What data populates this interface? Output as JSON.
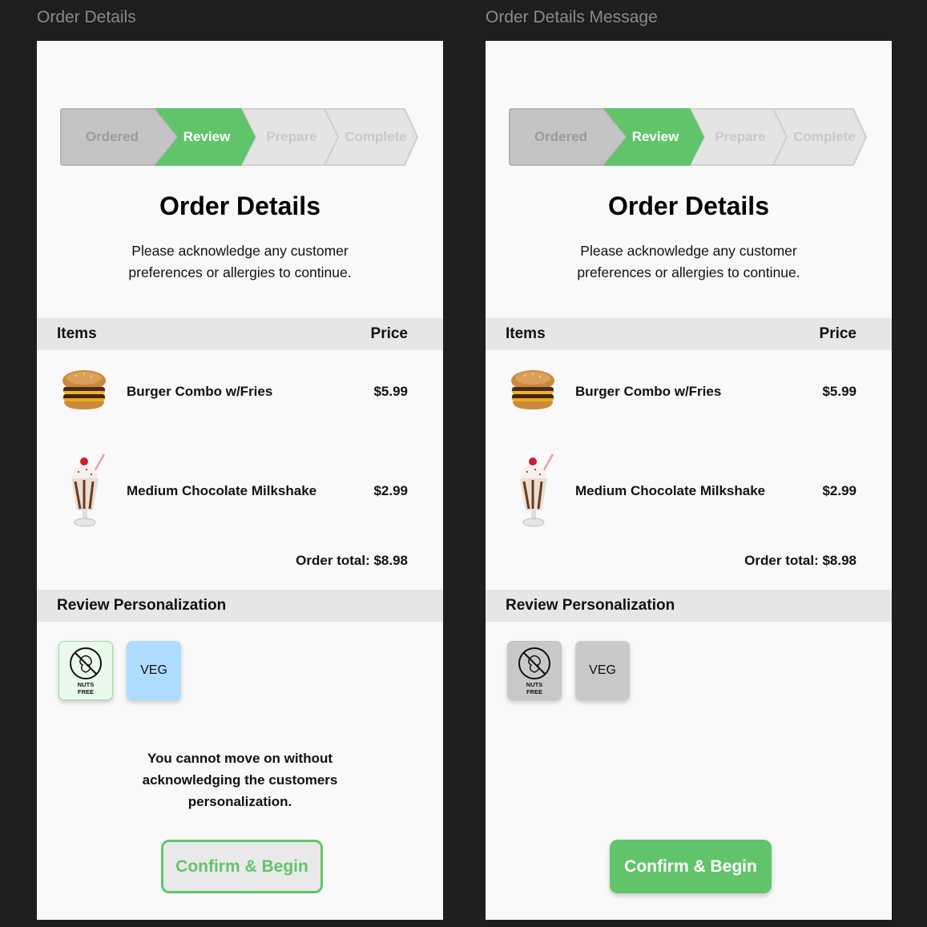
{
  "frames": [
    {
      "label": "Order Details",
      "steps": [
        "Ordered",
        "Review",
        "Prepare",
        "Complete"
      ],
      "title": "Order Details",
      "subtitle": "Please acknowledge  any customer\npreferences or allergies to continue.",
      "items_header": {
        "items": "Items",
        "price": "Price"
      },
      "items": [
        {
          "name": "Burger Combo w/Fries",
          "price": "$5.99",
          "icon": "burger-icon"
        },
        {
          "name": "Medium Chocolate Milkshake",
          "price": "$2.99",
          "icon": "milkshake-icon"
        }
      ],
      "order_total": "Order total: $8.98",
      "personalization_header": "Review Personalization",
      "badges": {
        "nuts": "NUTS\nFREE",
        "veg": "VEG"
      },
      "warning": "You cannot move on without\nacknowledging the customers\npersonalization.",
      "confirm_label": "Confirm & Begin"
    },
    {
      "label": "Order Details Message",
      "steps": [
        "Ordered",
        "Review",
        "Prepare",
        "Complete"
      ],
      "title": "Order Details",
      "subtitle": "Please acknowledge  any customer\npreferences or allergies to continue.",
      "items_header": {
        "items": "Items",
        "price": "Price"
      },
      "items": [
        {
          "name": "Burger Combo w/Fries",
          "price": "$5.99",
          "icon": "burger-icon"
        },
        {
          "name": "Medium Chocolate Milkshake",
          "price": "$2.99",
          "icon": "milkshake-icon"
        }
      ],
      "order_total": "Order total: $8.98",
      "personalization_header": "Review Personalization",
      "badges": {
        "nuts": "NUTS\nFREE",
        "veg": "VEG"
      },
      "confirm_label": "Confirm & Begin"
    }
  ],
  "colors": {
    "accent_green": "#62c46a",
    "step_done": "#c4c4c4",
    "step_pending": "#e4e4e4",
    "badge_nuts_active": "#eafaea",
    "badge_veg_active": "#aedcff",
    "badge_inactive": "#c9c9c9"
  }
}
